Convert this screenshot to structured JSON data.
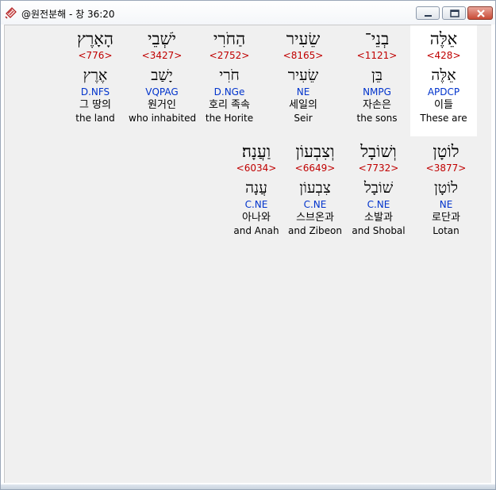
{
  "window": {
    "title": "@원전분해 - 창 36:20",
    "buttons": {
      "minimize": "minimize",
      "maximize": "maximize",
      "close": "close"
    }
  },
  "words": [
    {
      "hebrew": "אֵלֶּה",
      "strong": "<428>",
      "lexeme": "אֵלֶּה",
      "morph": "APDCP",
      "korean": "이들",
      "english": "These are",
      "selected": true
    },
    {
      "hebrew": "בְנֵי־",
      "strong": "<1121>",
      "lexeme": "בֵּן",
      "morph": "NMPG",
      "korean": "자손은",
      "english": "the sons"
    },
    {
      "hebrew": "שֵׂעִיר",
      "strong": "<8165>",
      "lexeme": "שֵׂעִיר",
      "morph": "NE",
      "korean": "세일의",
      "english": "Seir"
    },
    {
      "hebrew": "הַחֹרִי",
      "strong": "<2752>",
      "lexeme": "חֹרִי",
      "morph": "D.NGe",
      "korean": "호리 족속",
      "english": "the Horite"
    },
    {
      "hebrew": "יֹשְׁבֵי",
      "strong": "<3427>",
      "lexeme": "יָשַׁב",
      "morph": "VQPAG",
      "korean": "원거인",
      "english": "who inhabited"
    },
    {
      "hebrew": "הָאָרֶץ",
      "strong": "<776>",
      "lexeme": "אֶרֶץ",
      "morph": "D.NFS",
      "korean": "그 땅의",
      "english": "the land"
    },
    {
      "hebrew": "לוֹטָן",
      "strong": "<3877>",
      "lexeme": "לוֹטָן",
      "morph": "NE",
      "korean": "로단과",
      "english": "Lotan"
    },
    {
      "hebrew": "וְשׁוֹבָל",
      "strong": "<7732>",
      "lexeme": "שׁוֹבָל",
      "morph": "C.NE",
      "korean": "소발과",
      "english": "and Shobal"
    },
    {
      "hebrew": "וְצִבְעוֹן",
      "strong": "<6649>",
      "lexeme": "צִבְעוֹן",
      "morph": "C.NE",
      "korean": "스브온과",
      "english": "and Zibeon"
    },
    {
      "hebrew": "וַעֲנָה׃",
      "strong": "<6034>",
      "lexeme": "עֲנָה",
      "morph": "C.NE",
      "korean": "아나와",
      "english": "and Anah"
    }
  ]
}
